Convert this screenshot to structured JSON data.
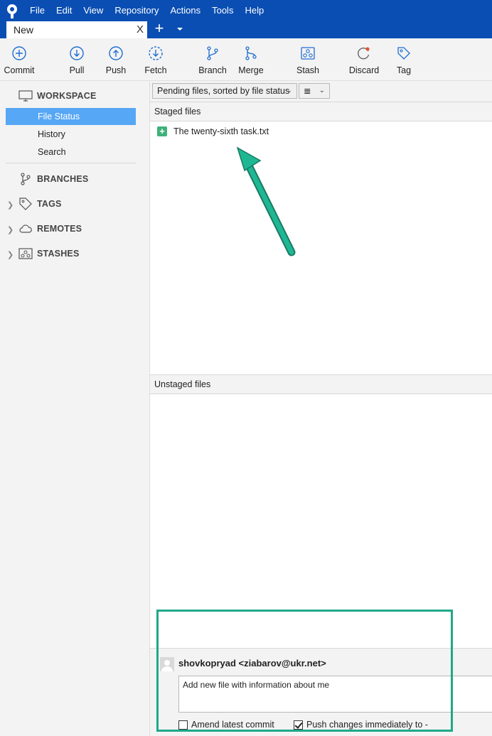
{
  "menu": [
    "File",
    "Edit",
    "View",
    "Repository",
    "Actions",
    "Tools",
    "Help"
  ],
  "tab": {
    "label": "New",
    "close": "X"
  },
  "toolbar": [
    {
      "id": "commit",
      "label": "Commit",
      "icon": "commit-icon"
    },
    {
      "id": "pull",
      "label": "Pull",
      "icon": "pull-icon"
    },
    {
      "id": "push",
      "label": "Push",
      "icon": "push-icon"
    },
    {
      "id": "fetch",
      "label": "Fetch",
      "icon": "fetch-icon"
    },
    {
      "id": "branch",
      "label": "Branch",
      "icon": "branch-icon"
    },
    {
      "id": "merge",
      "label": "Merge",
      "icon": "merge-icon"
    },
    {
      "id": "stash",
      "label": "Stash",
      "icon": "stash-icon"
    },
    {
      "id": "discard",
      "label": "Discard",
      "icon": "discard-icon"
    },
    {
      "id": "tag",
      "label": "Tag",
      "icon": "tag-icon"
    }
  ],
  "sidebar": {
    "workspace": "WORKSPACE",
    "items": [
      "File Status",
      "History",
      "Search"
    ],
    "branches": "BRANCHES",
    "tags": "TAGS",
    "remotes": "REMOTES",
    "stashes": "STASHES"
  },
  "filter": {
    "sort_label": "Pending files, sorted by file status",
    "view_icon": "≣"
  },
  "staged": {
    "title": "Staged files",
    "files": [
      "The twenty-sixth task.txt"
    ]
  },
  "unstaged": {
    "title": "Unstaged files"
  },
  "commit": {
    "author": "shovkopryad <ziabarov@ukr.net>",
    "message": "Add new file with information about me",
    "amend_label": "Amend latest commit",
    "push_label": "Push changes immediately to -"
  },
  "colors": {
    "titlebar": "#0a4eb3",
    "selection": "#56a7f5",
    "annotation": "#1fa889",
    "added_badge": "#3fb17a"
  }
}
